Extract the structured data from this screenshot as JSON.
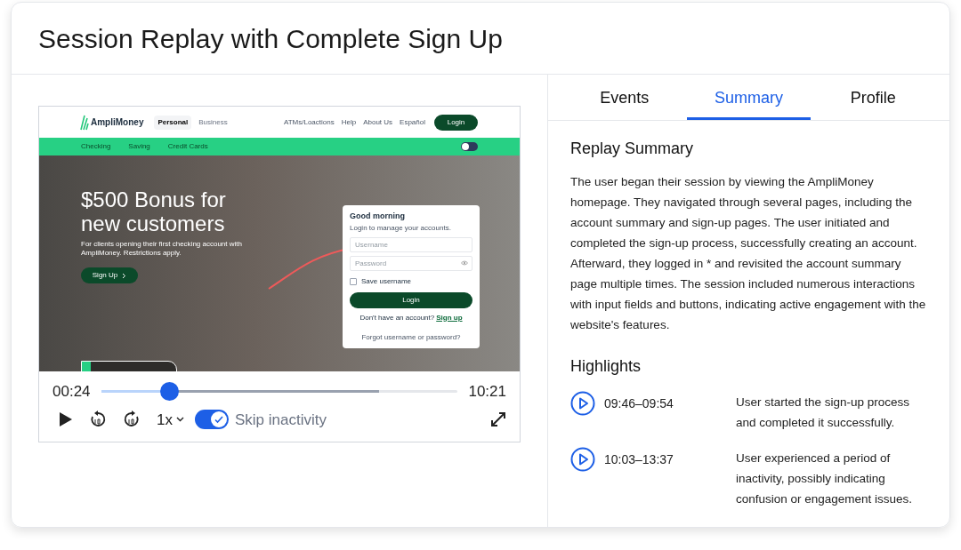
{
  "title": "Session Replay with Complete Sign Up",
  "site": {
    "logo": "AmpliMoney",
    "segments": [
      {
        "label": "Personal",
        "selected": true
      },
      {
        "label": "Business",
        "selected": false
      }
    ],
    "links": [
      "ATMs/Loactions",
      "Help",
      "About Us",
      "Español"
    ],
    "login_button": "Login",
    "nav": [
      "Checking",
      "Saving",
      "Credit Cards"
    ],
    "theme_toggle": {
      "on": false
    },
    "hero_title": "$500 Bonus for new customers",
    "hero_text": "For clients opening their first checking account with AmpliMoney. Restrictions apply.",
    "hero_button": "Sign Up",
    "login_card": {
      "title": "Good morning",
      "subtitle": "Login to manage your accounts.",
      "username": {
        "placeholder": "Username"
      },
      "password": {
        "placeholder": "Password"
      },
      "save_username": {
        "label": "Save username",
        "checked": false
      },
      "button": "Login",
      "signup_prompt": "Don't have an account?",
      "signup_link": "Sign up",
      "forgot": "Forgot username or password?"
    }
  },
  "player": {
    "current": "00:24",
    "total": "10:21",
    "progress": {
      "level": 0.19
    },
    "buffer": {
      "level": 0.78
    },
    "speed": "1x",
    "skip_inactivity": {
      "label": "Skip inactivity",
      "on": true
    }
  },
  "tabs": [
    {
      "label": "Events",
      "selected": false
    },
    {
      "label": "Summary",
      "selected": true
    },
    {
      "label": "Profile",
      "selected": false
    }
  ],
  "summary": {
    "heading": "Replay Summary",
    "text": "The user began their session by viewing the AmpliMoney homepage. They navigated through several pages, including the account summary and sign-up pages. The user initiated and completed the sign-up process, successfully creating an account. Afterward, they logged in * and revisited the account summary page multiple times. The session included numerous interactions with input fields and buttons, indicating active engagement with the website's features."
  },
  "highlights": {
    "heading": "Highlights",
    "items": [
      {
        "time": "09:46–09:54",
        "text": "User started the sign-up process and completed it successfully."
      },
      {
        "time": "10:03–13:37",
        "text": "User experienced a period of inactivity, possibly indicating confusion or engagement issues."
      }
    ]
  }
}
